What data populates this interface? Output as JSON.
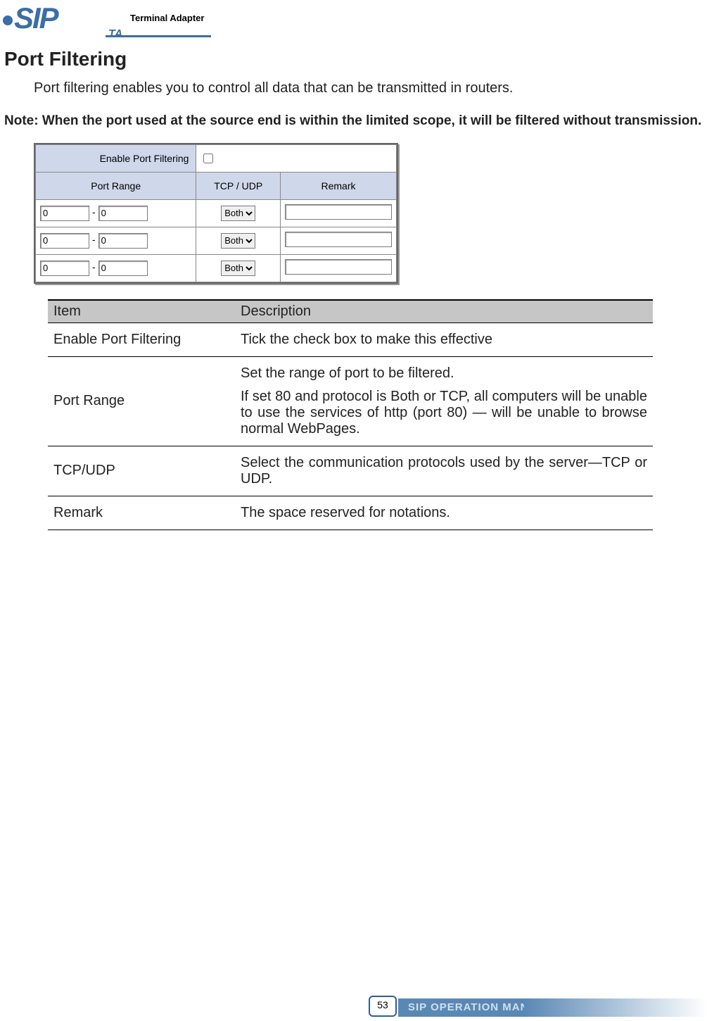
{
  "header": {
    "product_line": "Terminal Adapter",
    "logo_text": "SIP",
    "logo_sub": "TA"
  },
  "title": "Port Filtering",
  "intro": "Port filtering enables you to control all data that can be transmitted in routers.",
  "note": "Note: When the port used at the source end is within the limited scope, it will be filtered without transmission.",
  "screenshot": {
    "enable_label": "Enable Port Filtering",
    "col_port_range": "Port Range",
    "col_tcpudp": "TCP / UDP",
    "col_remark": "Remark",
    "select_option": "Both",
    "rows": [
      {
        "from": "0",
        "to": "0",
        "proto": "Both",
        "remark": ""
      },
      {
        "from": "0",
        "to": "0",
        "proto": "Both",
        "remark": ""
      },
      {
        "from": "0",
        "to": "0",
        "proto": "Both",
        "remark": ""
      }
    ]
  },
  "desc_table": {
    "head_item": "Item",
    "head_desc": "Description",
    "rows": [
      {
        "item": "Enable Port Filtering",
        "desc": [
          "Tick the check box to make this effective"
        ]
      },
      {
        "item": "Port Range",
        "desc": [
          "Set the range of port to be filtered.",
          "If set 80 and protocol is Both or TCP, all computers will be unable to use the services of http (port 80) — will be unable to browse normal WebPages."
        ]
      },
      {
        "item": "TCP/UDP",
        "desc": [
          "Select the communication protocols used by the server—TCP or UDP."
        ]
      },
      {
        "item": "Remark",
        "desc": [
          "The space reserved for notations."
        ]
      }
    ]
  },
  "footer": {
    "page_number": "53",
    "manual_title": "SIP OPERATION MANUAL"
  }
}
